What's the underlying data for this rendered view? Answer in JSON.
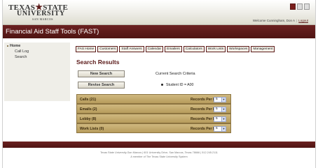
{
  "logo": {
    "line1_left": "TEXAS",
    "star": "★",
    "line1_right": "STATE",
    "line2": "UNIVERSITY",
    "line3": "SAN MARCOS"
  },
  "header": {
    "welcome": "Welcome Cunningham, Don A",
    "separator": "|",
    "logout": "Logout",
    "brand_color": "#5b1a19"
  },
  "titlebar": {
    "title": "Financial Aid Staff Tools (FAST)"
  },
  "sidebar": {
    "home": "Home",
    "items": [
      {
        "label": "Call Log"
      },
      {
        "label": "Search"
      }
    ]
  },
  "tabs": [
    "FAS Home",
    "Customers",
    "Staff Answers",
    "Calendar",
    "Emailers",
    "Calculators",
    "Work Lists",
    "Workspaces",
    "Management"
  ],
  "main": {
    "heading": "Search Results",
    "new_search": "New Search",
    "revise_search": "Revise Search",
    "criteria_title": "Current Search Criteria",
    "criteria_item": "Student ID = A00"
  },
  "results": {
    "rows": [
      {
        "label": "Calls (21)",
        "rpp_label": "Records Per Page:",
        "rpp_value": "5"
      },
      {
        "label": "Emails (2)",
        "rpp_label": "Records Per Page:",
        "rpp_value": "5"
      },
      {
        "label": "Lobby (8)",
        "rpp_label": "Records Per Page:",
        "rpp_value": "5"
      },
      {
        "label": "Work Lists (0)",
        "rpp_label": "Records Per Page:",
        "rpp_value": "5"
      }
    ],
    "dropdown_arrow": "▼"
  },
  "footer": {
    "line1": "Texas State University-San Marcos | 601 University Drive, San Marcos, Texas 78666 | 512.245.2111",
    "line2": "A member of The Texas State University System"
  }
}
